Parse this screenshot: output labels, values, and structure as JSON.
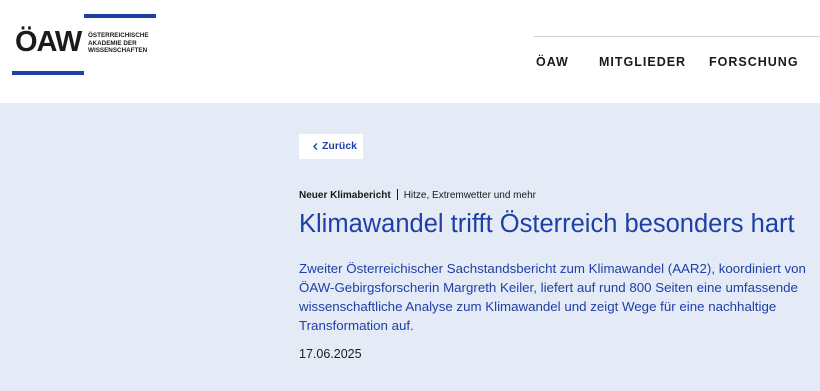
{
  "logo": {
    "mark": "ÖAW",
    "lines": [
      "ÖSTERREICHISCHE",
      "AKADEMIE DER",
      "WISSENSCHAFTEN"
    ]
  },
  "nav": {
    "items": [
      {
        "label": "ÖAW"
      },
      {
        "label": "MITGLIEDER"
      },
      {
        "label": "FORSCHUNG"
      }
    ]
  },
  "article": {
    "back_label": "Zurück",
    "kicker_category": "Neuer Klimabericht",
    "kicker_topic": "Hitze, Extremwetter und mehr",
    "title": "Klimawandel trifft Österreich besonders hart",
    "lead": "Zweiter Österreichischer Sachstandsbericht zum Klimawandel (AAR2), koordiniert von ÖAW-Gebirgsforscherin Margreth Keiler, liefert auf rund 800 Seiten eine umfassende wissenschaftliche Analyse zum Klimawandel und zeigt Wege für eine nachhaltige Transformation auf.",
    "date": "17.06.2025"
  },
  "colors": {
    "brand_blue": "#1f3fa8",
    "content_background": "#e4ebf6"
  }
}
